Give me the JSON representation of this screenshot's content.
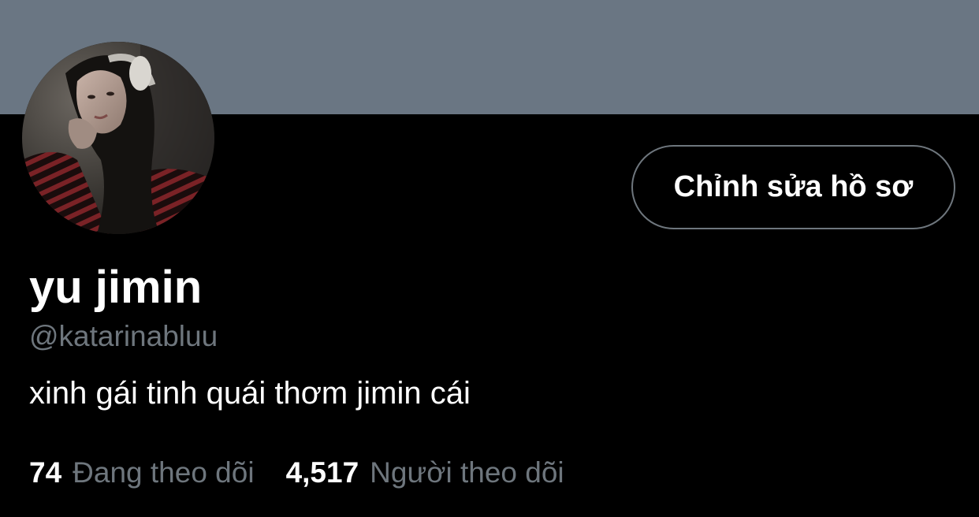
{
  "profile": {
    "display_name": "yu jimin",
    "handle": "@katarinabluu",
    "bio": "xinh gái tinh quái thơm jimin cái",
    "avatar_icon": "profile-photo",
    "edit_profile_label": "Chỉnh sửa hồ sơ"
  },
  "stats": {
    "following_count": "74",
    "following_label": "Đang theo dõi",
    "followers_count": "4,517",
    "followers_label": "Người theo dõi"
  },
  "colors": {
    "banner": "#6a7683",
    "background": "#000000",
    "text_primary": "#ffffff",
    "text_secondary": "#6e767d",
    "button_border": "#6e767d"
  }
}
